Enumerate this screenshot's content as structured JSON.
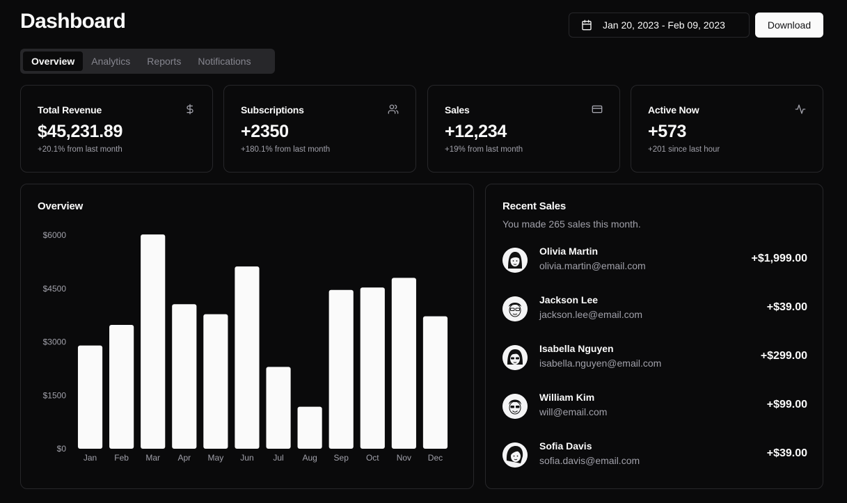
{
  "header": {
    "title": "Dashboard",
    "date_range": "Jan 20, 2023 - Feb 09, 2023",
    "download_label": "Download"
  },
  "tabs": [
    {
      "label": "Overview",
      "active": true
    },
    {
      "label": "Analytics",
      "active": false
    },
    {
      "label": "Reports",
      "active": false
    },
    {
      "label": "Notifications",
      "active": false
    }
  ],
  "stats": [
    {
      "label": "Total Revenue",
      "value": "$45,231.89",
      "sub": "+20.1% from last month",
      "icon": "dollar-icon"
    },
    {
      "label": "Subscriptions",
      "value": "+2350",
      "sub": "+180.1% from last month",
      "icon": "users-icon"
    },
    {
      "label": "Sales",
      "value": "+12,234",
      "sub": "+19% from last month",
      "icon": "credit-card-icon"
    },
    {
      "label": "Active Now",
      "value": "+573",
      "sub": "+201 since last hour",
      "icon": "activity-icon"
    }
  ],
  "overview": {
    "title": "Overview"
  },
  "recent_sales": {
    "title": "Recent Sales",
    "description": "You made 265 sales this month.",
    "items": [
      {
        "name": "Olivia Martin",
        "email": "olivia.martin@email.com",
        "amount": "+$1,999.00"
      },
      {
        "name": "Jackson Lee",
        "email": "jackson.lee@email.com",
        "amount": "+$39.00"
      },
      {
        "name": "Isabella Nguyen",
        "email": "isabella.nguyen@email.com",
        "amount": "+$299.00"
      },
      {
        "name": "William Kim",
        "email": "will@email.com",
        "amount": "+$99.00"
      },
      {
        "name": "Sofia Davis",
        "email": "sofia.davis@email.com",
        "amount": "+$39.00"
      }
    ]
  },
  "colors": {
    "background": "#0a0a0b",
    "border": "#27272a",
    "foreground": "#fafafa",
    "muted": "#a1a1aa",
    "bar": "#fafafa"
  },
  "chart_data": {
    "type": "bar",
    "categories": [
      "Jan",
      "Feb",
      "Mar",
      "Apr",
      "May",
      "Jun",
      "Jul",
      "Aug",
      "Sep",
      "Oct",
      "Nov",
      "Dec"
    ],
    "values": [
      2900,
      3480,
      6020,
      4060,
      3780,
      5120,
      2300,
      1180,
      4460,
      4530,
      4800,
      3720
    ],
    "y_ticks": [
      "$0",
      "$1500",
      "$3000",
      "$4500",
      "$6000"
    ],
    "ylim": [
      0,
      6000
    ],
    "grid": false,
    "title": "Overview"
  }
}
